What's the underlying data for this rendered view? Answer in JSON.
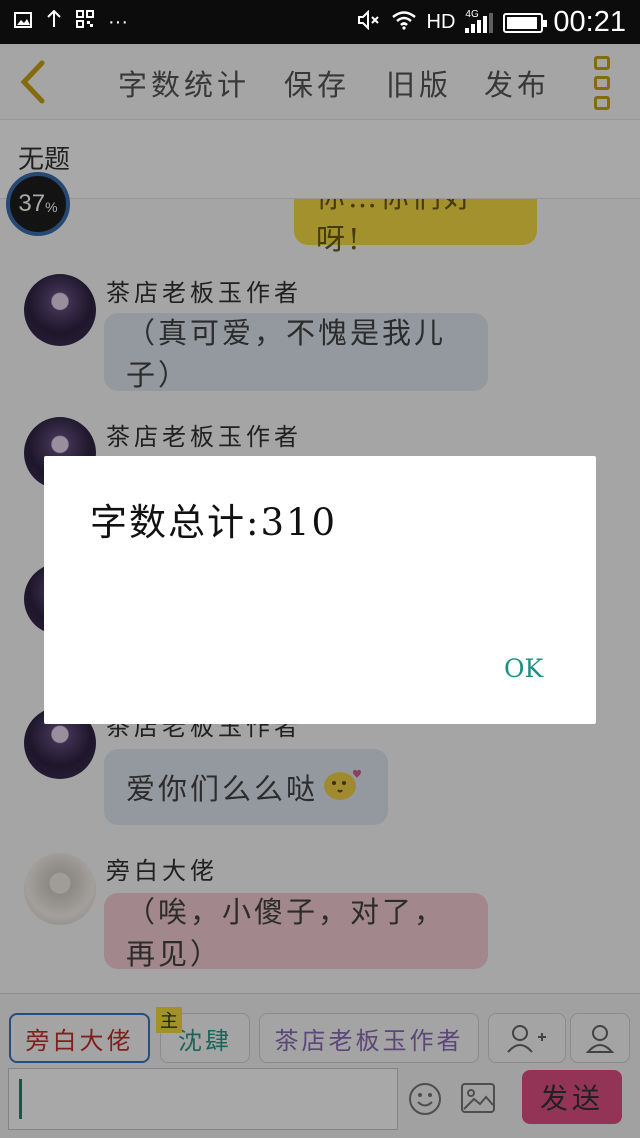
{
  "status_bar": {
    "hd": "HD",
    "network": "4G",
    "time": "00:21",
    "more": "···"
  },
  "toolbar": {
    "word_count": "字数统计",
    "save": "保存",
    "old_version": "旧版",
    "publish": "发布"
  },
  "doc_title": "无题",
  "progress_gauge": {
    "value": "37",
    "unit": "%"
  },
  "messages": [
    {
      "type": "self",
      "text": "你…你们好呀!",
      "color": "#f6dd45"
    },
    {
      "type": "other",
      "name": "茶店老板玉作者",
      "text": "（真可爱，不愧是我儿子）",
      "color": "#e1e9f3"
    },
    {
      "type": "other",
      "name": "茶店老板玉作者"
    },
    {
      "type": "other",
      "name": "茶店老板玉作者",
      "text": "爱你们么么哒",
      "emoji": "kissing-face"
    },
    {
      "type": "other",
      "name": "旁白大佬",
      "text": "（唉，小傻子，对了，再见）",
      "color": "#f6cdd6"
    }
  ],
  "roles": [
    {
      "label": "旁白大佬",
      "color": "#c6302b",
      "active": true
    },
    {
      "label": "沈肆",
      "color": "#2a9a8a",
      "main_tag": "主"
    },
    {
      "label": "茶店老板玉作者",
      "color": "#8a6db8"
    }
  ],
  "input": {
    "value": ""
  },
  "send_label": "发送",
  "dialog": {
    "message": "字数总计:310",
    "ok": "OK"
  }
}
